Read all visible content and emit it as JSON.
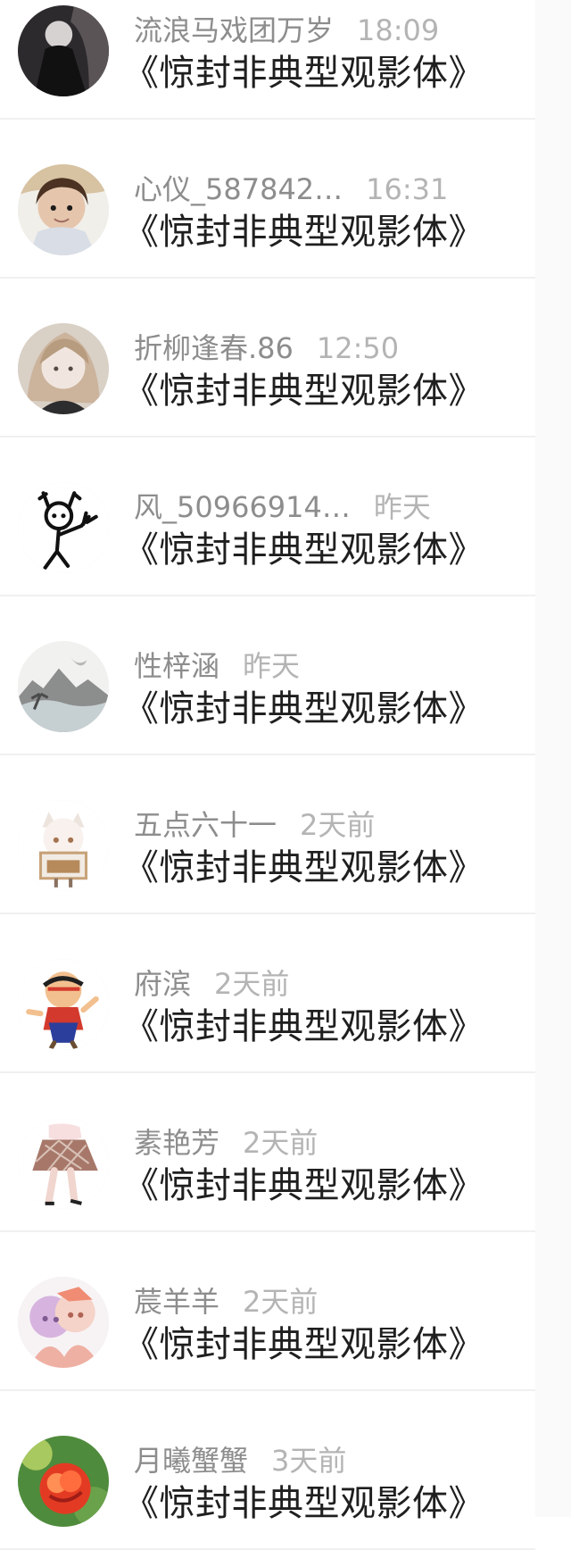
{
  "messages": [
    {
      "name": "流浪马戏团万岁",
      "time": "18:09",
      "text": "惊封非典型观影体",
      "avatar": "dark-anime-avatar",
      "avatar_colors": [
        "#4a4649",
        "#1d1b1e",
        "#d6d2d4"
      ]
    },
    {
      "name": "心仪_587842…",
      "time": "16:31",
      "text": "惊封非典型观影体",
      "avatar": "child-photo-avatar",
      "avatar_colors": [
        "#f2f1ee",
        "#7f5a3b",
        "#e1c2a8"
      ]
    },
    {
      "name": "折柳逢春.86",
      "time": "12:50",
      "text": "惊封非典型观影体",
      "avatar": "anime-girl-avatar",
      "avatar_colors": [
        "#d8d0c5",
        "#f0e6dd",
        "#b09d88"
      ]
    },
    {
      "name": "风_50966914…",
      "time": "昨天",
      "text": "惊封非典型观影体",
      "avatar": "stick-figure-avatar",
      "avatar_colors": [
        "#ffffff",
        "#111111",
        "#111111"
      ]
    },
    {
      "name": "性梓涵",
      "time": "昨天",
      "text": "惊封非典型观影体",
      "avatar": "ink-landscape-avatar",
      "avatar_colors": [
        "#f1f1ef",
        "#6d6d6d",
        "#9aa5a8"
      ]
    },
    {
      "name": "五点六十一",
      "time": "2天前",
      "text": "惊封非典型观影体",
      "avatar": "chibi-character-avatar",
      "avatar_colors": [
        "#ffffff",
        "#e9dccd",
        "#b68a5b"
      ]
    },
    {
      "name": "府滨",
      "time": "2天前",
      "text": "惊封非典型观影体",
      "avatar": "cartoon-boy-avatar",
      "avatar_colors": [
        "#ffffff",
        "#f1a25c",
        "#2c3e9b"
      ]
    },
    {
      "name": "素艳芳",
      "time": "2天前",
      "text": "惊封非典型观影体",
      "avatar": "skirt-drawing-avatar",
      "avatar_colors": [
        "#ffffff",
        "#9b6a58",
        "#e8c7be"
      ]
    },
    {
      "name": "莀羊羊",
      "time": "2天前",
      "text": "惊封非典型观影体",
      "avatar": "anime-pair-avatar",
      "avatar_colors": [
        "#f5f2f4",
        "#d7b4df",
        "#efb0a4"
      ]
    },
    {
      "name": "月曦蟹蟹",
      "time": "3天前",
      "text": "惊封非典型观影体",
      "avatar": "red-rose-avatar",
      "avatar_colors": [
        "#4f8b3c",
        "#e33b23",
        "#ff8f54"
      ]
    }
  ]
}
